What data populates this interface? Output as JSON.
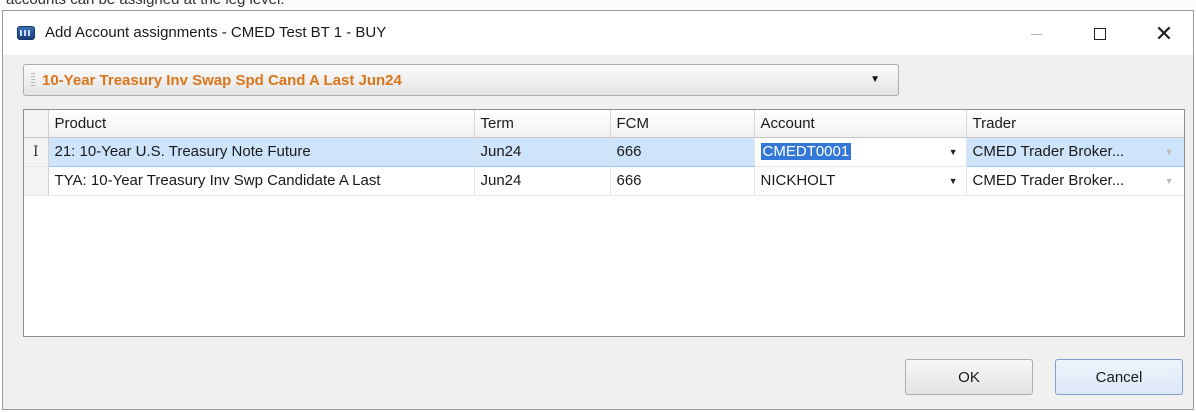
{
  "background": {
    "caption": "accounts can be assigned at the leg level."
  },
  "window": {
    "title": "Add Account assignments - CMED Test BT 1 - BUY",
    "controls": {
      "close": "✕"
    }
  },
  "strategy_combo": {
    "value": "10-Year Treasury Inv Swap Spd Cand A Last Jun24"
  },
  "grid": {
    "columns": [
      "Product",
      "Term",
      "FCM",
      "Account",
      "Trader"
    ],
    "rows": [
      {
        "marker": "I",
        "product": "21: 10-Year U.S. Treasury Note Future",
        "term": "Jun24",
        "fcm": "666",
        "account": "CMEDT0001",
        "trader": "CMED Trader Broker...",
        "selected": true
      },
      {
        "marker": "",
        "product": "TYA: 10-Year Treasury Inv Swp Candidate A Last",
        "term": "Jun24",
        "fcm": "666",
        "account": "NICKHOLT",
        "trader": "CMED Trader Broker...",
        "selected": false
      }
    ]
  },
  "buttons": {
    "ok": "OK",
    "cancel": "Cancel"
  },
  "colors": {
    "combo_text": "#d9751a",
    "selection": "#cde4fb",
    "account_highlight": "#3378d6"
  }
}
